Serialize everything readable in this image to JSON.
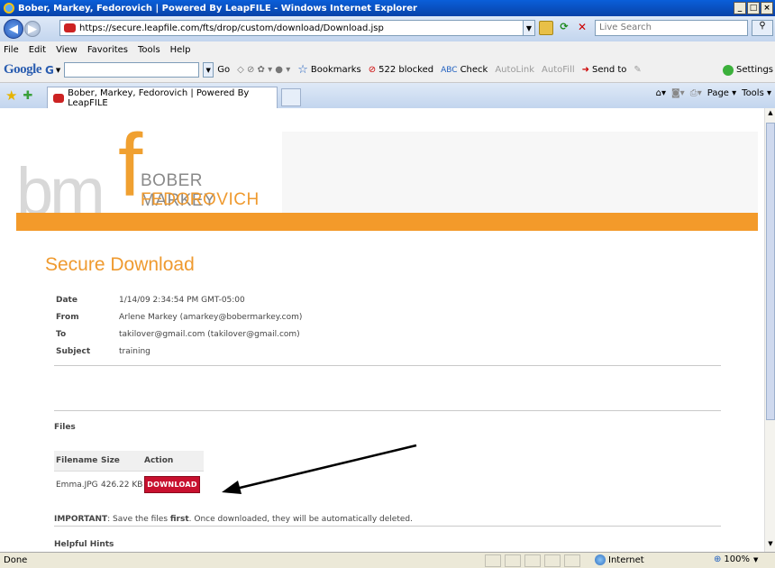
{
  "window": {
    "title": "Bober, Markey, Fedorovich | Powered By LeapFILE - Windows Internet Explorer"
  },
  "address": {
    "url": "https://secure.leapfile.com/fts/drop/custom/download/Download.jsp"
  },
  "search": {
    "placeholder": "Live Search"
  },
  "menu": [
    "File",
    "Edit",
    "View",
    "Favorites",
    "Tools",
    "Help"
  ],
  "google_toolbar": {
    "logo": "Google",
    "g_letter": "G",
    "go": "Go",
    "bookmarks": "Bookmarks",
    "blocked": "522 blocked",
    "check": "Check",
    "autolink": "AutoLink",
    "autofill": "AutoFill",
    "send_to": "Send to",
    "settings": "Settings"
  },
  "tab": {
    "title": "Bober, Markey, Fedorovich | Powered By LeapFILE"
  },
  "command_bar": {
    "page": "Page",
    "tools": "Tools"
  },
  "logo": {
    "letters_bm": "bm",
    "letter_f": "f",
    "line1": "BOBER MARKEY",
    "line2": "FEDOROVICH"
  },
  "page": {
    "title": "Secure Download"
  },
  "meta": {
    "date_label": "Date",
    "date_value": "1/14/09 2:34:54 PM GMT-05:00",
    "from_label": "From",
    "from_value": "Arlene Markey (amarkey@bobermarkey.com)",
    "to_label": "To",
    "to_value": "takilover@gmail.com (takilover@gmail.com)",
    "subject_label": "Subject",
    "subject_value": "training"
  },
  "files": {
    "heading": "Files",
    "col_filename": "Filename",
    "col_size": "Size",
    "col_action": "Action",
    "rows": [
      {
        "filename": "Emma.JPG",
        "size": "426.22 KB",
        "action": "DOWNLOAD"
      }
    ]
  },
  "important": {
    "label": "IMPORTANT",
    "text_a": ": Save the files ",
    "text_b": "first",
    "text_c": ". Once downloaded, they will be automatically deleted."
  },
  "helpful_hints": "Helpful Hints",
  "status": {
    "left": "Done",
    "zone": "Internet",
    "zoom": "100%"
  },
  "colors": {
    "accent": "#f39a2a",
    "download_button": "#c8102e"
  }
}
